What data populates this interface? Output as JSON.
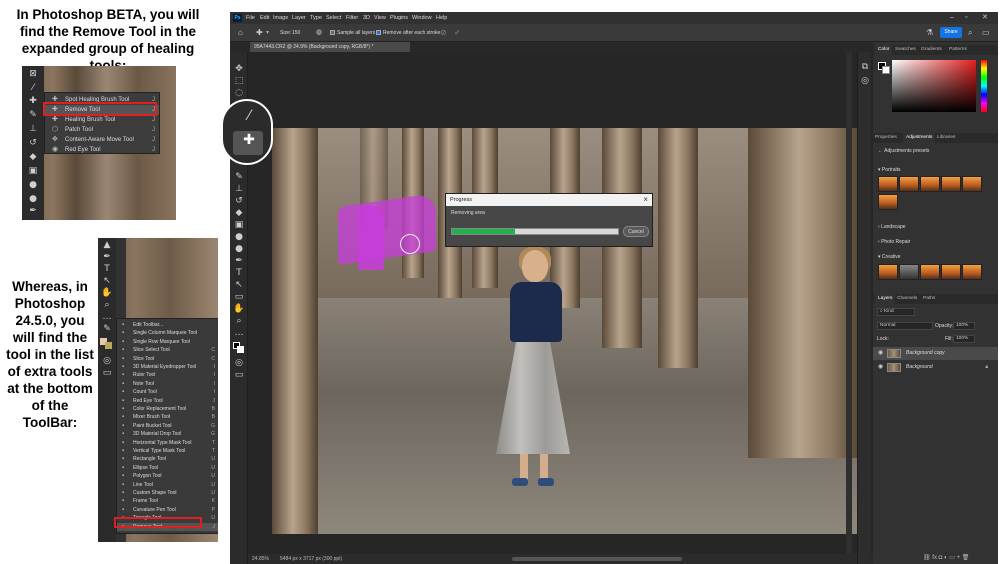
{
  "captions": {
    "beta": "In Photoshop BETA, you will find the Remove Tool in the expanded group of healing tools:",
    "classic": "Whereas, in Photoshop 24.5.0, you will find the tool in the list of extra tools at the bottom of the ToolBar:"
  },
  "beta_flyout": [
    {
      "label": "Spot Healing Brush Tool",
      "key": "J"
    },
    {
      "label": "Remove Tool",
      "key": "J",
      "selected": true
    },
    {
      "label": "Healing Brush Tool",
      "key": "J"
    },
    {
      "label": "Patch Tool",
      "key": "J"
    },
    {
      "label": "Content-Aware Move Tool",
      "key": "J"
    },
    {
      "label": "Red Eye Tool",
      "key": "J"
    }
  ],
  "extra_tools": [
    {
      "label": "Edit Toolbar...",
      "key": ""
    },
    {
      "label": "Single Column Marquee Tool",
      "key": ""
    },
    {
      "label": "Single Row Marquee Tool",
      "key": ""
    },
    {
      "label": "Slice Select Tool",
      "key": "C"
    },
    {
      "label": "Slice Tool",
      "key": "C"
    },
    {
      "label": "3D Material Eyedropper Tool",
      "key": "I"
    },
    {
      "label": "Ruler Tool",
      "key": "I"
    },
    {
      "label": "Note Tool",
      "key": "I"
    },
    {
      "label": "Count Tool",
      "key": "I"
    },
    {
      "label": "Red Eye Tool",
      "key": "J"
    },
    {
      "label": "Color Replacement Tool",
      "key": "B"
    },
    {
      "label": "Mixer Brush Tool",
      "key": "B"
    },
    {
      "label": "Paint Bucket Tool",
      "key": "G"
    },
    {
      "label": "3D Material Drop Tool",
      "key": "G"
    },
    {
      "label": "Horizontal Type Mask Tool",
      "key": "T"
    },
    {
      "label": "Vertical Type Mask Tool",
      "key": "T"
    },
    {
      "label": "Rectangle Tool",
      "key": "U"
    },
    {
      "label": "Ellipse Tool",
      "key": "U"
    },
    {
      "label": "Polygon Tool",
      "key": "U"
    },
    {
      "label": "Line Tool",
      "key": "U"
    },
    {
      "label": "Custom Shape Tool",
      "key": "U"
    },
    {
      "label": "Frame Tool",
      "key": "K"
    },
    {
      "label": "Curvature Pen Tool",
      "key": "P"
    },
    {
      "label": "Triangle Tool",
      "key": "U"
    },
    {
      "label": "Remove Tool",
      "key": "J",
      "selected": true
    }
  ],
  "ps": {
    "logo": "Ps",
    "menu": [
      "File",
      "Edit",
      "Image",
      "Layer",
      "Type",
      "Select",
      "Filter",
      "3D",
      "View",
      "Plugins",
      "Window",
      "Help"
    ],
    "options": {
      "size_label": "Size:",
      "size_value": "150",
      "sample_all_layers": "Sample all layers",
      "remove_after_stroke": "Remove after each stroke"
    },
    "share": "Share",
    "doc_tab": "95A7443.CR2 @ 24.9% (Background copy, RGB/8*) *",
    "progress": {
      "title": "Progress",
      "message": "Removing area",
      "fraction": 0.38,
      "cancel": "Cancel"
    },
    "status": {
      "zoom": "24.85%",
      "dims": "5484 px x 3717 px (300 ppi)"
    }
  },
  "panels": {
    "color_tabs": [
      "Color",
      "Swatches",
      "Gradients",
      "Patterns"
    ],
    "adj_tabs": [
      "Properties",
      "Adjustments",
      "Libraries"
    ],
    "adj_title": "Adjustments presets",
    "groups": [
      "Portraits",
      "Landscape",
      "Photo Repair",
      "Creative"
    ],
    "layers_tabs": [
      "Layers",
      "Channels",
      "Paths"
    ],
    "kind": "Kind",
    "blend": "Normal",
    "opacity_label": "Opacity:",
    "opacity_value": "100%",
    "lock_label": "Lock:",
    "fill_label": "Fill:",
    "fill_value": "100%",
    "layers": [
      "Background copy",
      "Background"
    ]
  }
}
